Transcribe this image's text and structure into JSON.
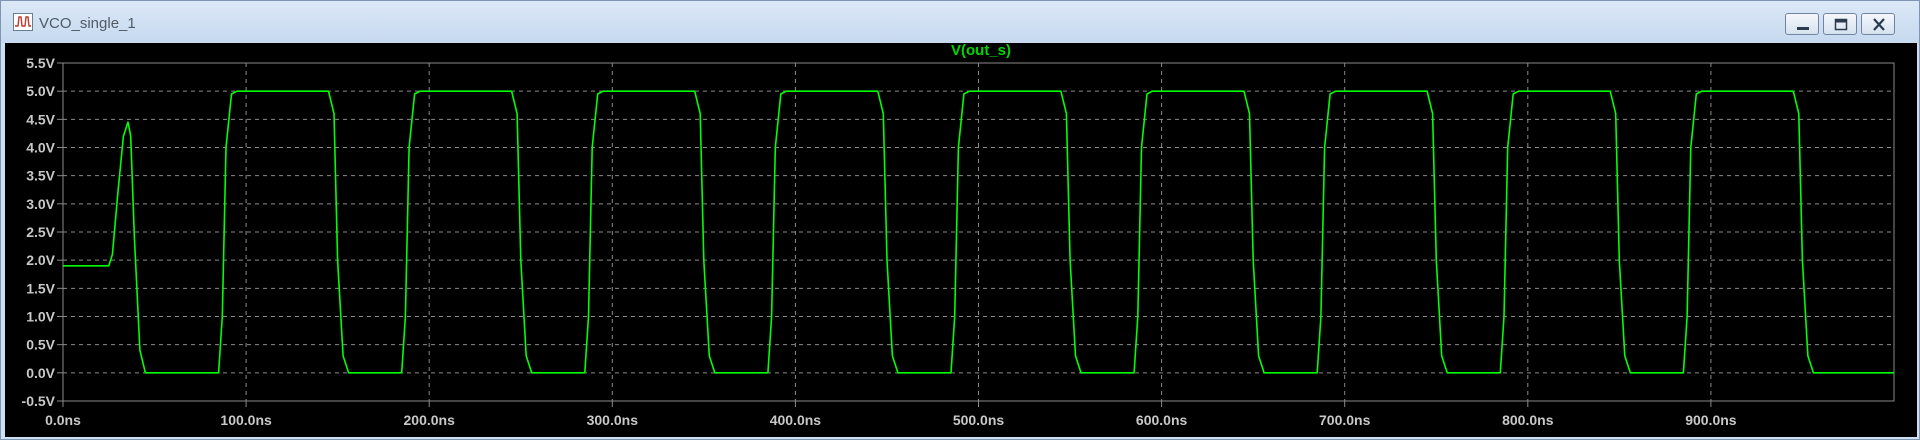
{
  "window": {
    "title": "VCO_single_1"
  },
  "titlebar_buttons": {
    "minimize_icon": "minimize-icon",
    "restore_icon": "restore-icon",
    "close_icon": "close-icon"
  },
  "colors": {
    "background": "#000000",
    "trace": "#00ff00",
    "grid": "#8a8a8a",
    "ticks": "#c8c8c8"
  },
  "chart_data": {
    "type": "line",
    "title": "V(out_s)",
    "xlabel": "",
    "ylabel": "",
    "xlim": [
      0,
      1000
    ],
    "ylim": [
      -0.5,
      5.5
    ],
    "x_unit": "ns",
    "y_unit": "V",
    "grid": true,
    "xticks": [
      0,
      100,
      200,
      300,
      400,
      500,
      600,
      700,
      800,
      900
    ],
    "xtick_labels": [
      "0.0ns",
      "100.0ns",
      "200.0ns",
      "300.0ns",
      "400.0ns",
      "500.0ns",
      "600.0ns",
      "700.0ns",
      "800.0ns",
      "900.0ns"
    ],
    "yticks": [
      -0.5,
      0,
      0.5,
      1,
      1.5,
      2,
      2.5,
      3,
      3.5,
      4,
      4.5,
      5,
      5.5
    ],
    "ytick_labels": [
      "-0.5V",
      "0.0V",
      "0.5V",
      "1.0V",
      "1.5V",
      "2.0V",
      "2.5V",
      "3.0V",
      "3.5V",
      "4.0V",
      "4.5V",
      "5.0V",
      "5.5V"
    ],
    "series": [
      {
        "name": "V(out_s)",
        "x": [
          0,
          25,
          27,
          30,
          33,
          35.5,
          37,
          39,
          42,
          45,
          85,
          87,
          89,
          92,
          95,
          145,
          148,
          150,
          153,
          156,
          185,
          187,
          189,
          192,
          195,
          245,
          248,
          250,
          253,
          256,
          285,
          287,
          289,
          292,
          295,
          345,
          348,
          350,
          353,
          356,
          385,
          387,
          389,
          392,
          395,
          445,
          448,
          450,
          453,
          456,
          485,
          487,
          489,
          492,
          495,
          545,
          548,
          550,
          553,
          556,
          585,
          587,
          589,
          592,
          595,
          645,
          648,
          650,
          653,
          656,
          685,
          687,
          689,
          692,
          695,
          745,
          748,
          750,
          753,
          756,
          785,
          787,
          789,
          792,
          795,
          845,
          848,
          850,
          853,
          856,
          885,
          887,
          889,
          892,
          895,
          945,
          948,
          950,
          953,
          956,
          985,
          990,
          1000
        ],
        "y": [
          1.9,
          1.9,
          2.1,
          3.2,
          4.2,
          4.45,
          4.2,
          2.4,
          0.4,
          0.0,
          0.0,
          1.0,
          4.0,
          4.95,
          5.0,
          5.0,
          4.6,
          2.0,
          0.3,
          0.0,
          0.0,
          1.0,
          4.0,
          4.95,
          5.0,
          5.0,
          4.6,
          2.0,
          0.3,
          0.0,
          0.0,
          1.0,
          4.0,
          4.95,
          5.0,
          5.0,
          4.6,
          2.0,
          0.3,
          0.0,
          0.0,
          1.0,
          4.0,
          4.95,
          5.0,
          5.0,
          4.6,
          2.0,
          0.3,
          0.0,
          0.0,
          1.0,
          4.0,
          4.95,
          5.0,
          5.0,
          4.6,
          2.0,
          0.3,
          0.0,
          0.0,
          1.0,
          4.0,
          4.95,
          5.0,
          5.0,
          4.6,
          2.0,
          0.3,
          0.0,
          0.0,
          1.0,
          4.0,
          4.95,
          5.0,
          5.0,
          4.6,
          2.0,
          0.3,
          0.0,
          0.0,
          1.0,
          4.0,
          4.95,
          5.0,
          5.0,
          4.6,
          2.0,
          0.3,
          0.0,
          0.0,
          1.0,
          4.0,
          4.95,
          5.0,
          5.0,
          4.6,
          2.0,
          0.3,
          0.0,
          0.0,
          0.0,
          0.0
        ]
      }
    ]
  }
}
